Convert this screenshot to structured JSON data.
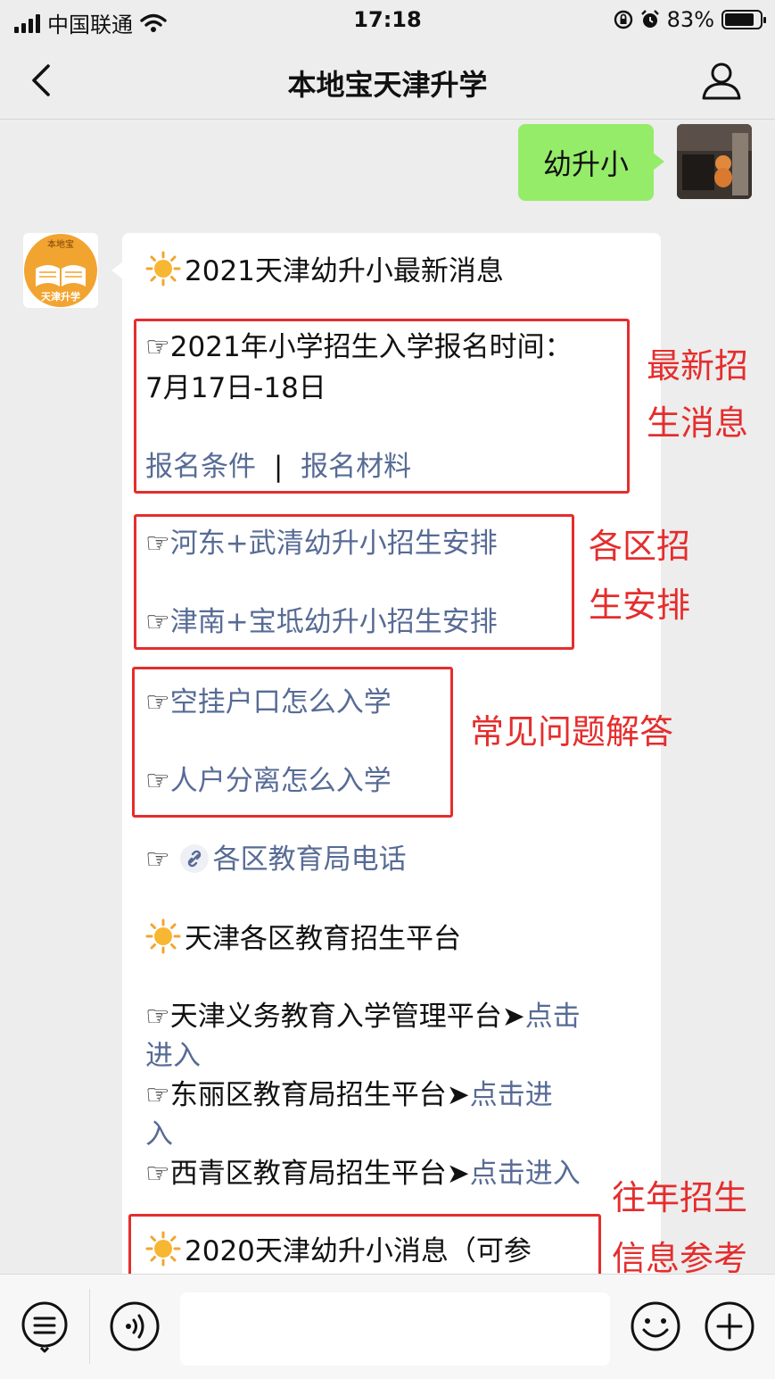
{
  "status_bar": {
    "carrier": "中国联通",
    "time": "17:18",
    "battery": "83%",
    "battery_level": 0.83
  },
  "header": {
    "title": "本地宝天津升学"
  },
  "outgoing_message": {
    "text": "幼升小"
  },
  "bot_avatar": {
    "top_text": "本地宝",
    "bottom_text": "天津升学"
  },
  "reply": {
    "heading_2021": "2021天津幼升小最新消息",
    "latest": {
      "line1": "☞2021年小学招生入学报名时间：",
      "line2": "7月17日-18日",
      "link_conditions": "报名条件",
      "separator": "|",
      "link_materials": "报名材料"
    },
    "district_links": [
      "河东+武清幼升小招生安排",
      "津南+宝坻幼升小招生安排"
    ],
    "faq_links": [
      "空挂户口怎么入学",
      "人户分离怎么入学"
    ],
    "phone_link": "各区教育局电话",
    "platform_heading": "天津各区教育招生平台",
    "platforms": [
      {
        "name": "☞天津义务教育入学管理平台➤",
        "link_a": "点击",
        "link_b": "进入"
      },
      {
        "name": "☞东丽区教育局招生平台➤",
        "link_a": "点击进",
        "link_b": "入"
      },
      {
        "name": "☞西青区教育局招生平台➤",
        "link_a": "点击进入"
      }
    ],
    "heading_2020": "2020天津幼升小消息（可参"
  },
  "annotations": {
    "latest": [
      "最新招",
      "生消息"
    ],
    "district": [
      "各区招",
      "生安排"
    ],
    "faq": "常见问题解答",
    "past": [
      "往年招生",
      "信息参考"
    ]
  },
  "colors": {
    "link": "#576b95",
    "annotation": "#e52d2d",
    "outgoing_bubble": "#95ec69"
  }
}
